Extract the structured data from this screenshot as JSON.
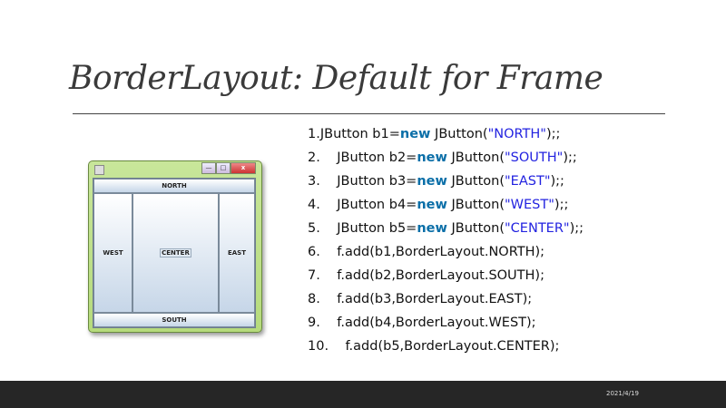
{
  "title": "BorderLayout: Default for Frame",
  "window": {
    "north": "NORTH",
    "south": "SOUTH",
    "east": "EAST",
    "west": "WEST",
    "center": "CENTER",
    "minimize": "—",
    "maximize": "□",
    "close": "x"
  },
  "code": [
    {
      "num": "1.",
      "indent": "",
      "pre": "JButton b1=",
      "kw": "new",
      "mid": " JButton(",
      "str": "\"NORTH\"",
      "post": ");;"
    },
    {
      "num": "2.",
      "indent": "    ",
      "pre": "JButton b2=",
      "kw": "new",
      "mid": " JButton(",
      "str": "\"SOUTH\"",
      "post": ");;"
    },
    {
      "num": "3.",
      "indent": "    ",
      "pre": "JButton b3=",
      "kw": "new",
      "mid": " JButton(",
      "str": "\"EAST\"",
      "post": ");;"
    },
    {
      "num": "4.",
      "indent": "    ",
      "pre": "JButton b4=",
      "kw": "new",
      "mid": " JButton(",
      "str": "\"WEST\"",
      "post": ");;"
    },
    {
      "num": "5.",
      "indent": "    ",
      "pre": "JButton b5=",
      "kw": "new",
      "mid": " JButton(",
      "str": "\"CENTER\"",
      "post": ");;"
    },
    {
      "num": "6.",
      "indent": "    ",
      "pre": "f.add(b1,BorderLayout.NORTH);"
    },
    {
      "num": "7.",
      "indent": "    ",
      "pre": "f.add(b2,BorderLayout.SOUTH);"
    },
    {
      "num": "8.",
      "indent": "    ",
      "pre": "f.add(b3,BorderLayout.EAST);"
    },
    {
      "num": "9.",
      "indent": "    ",
      "pre": "f.add(b4,BorderLayout.WEST);"
    },
    {
      "num": "10.",
      "indent": "    ",
      "pre": "f.add(b5,BorderLayout.CENTER);"
    }
  ],
  "footer": {
    "date": "2021/4/19"
  }
}
